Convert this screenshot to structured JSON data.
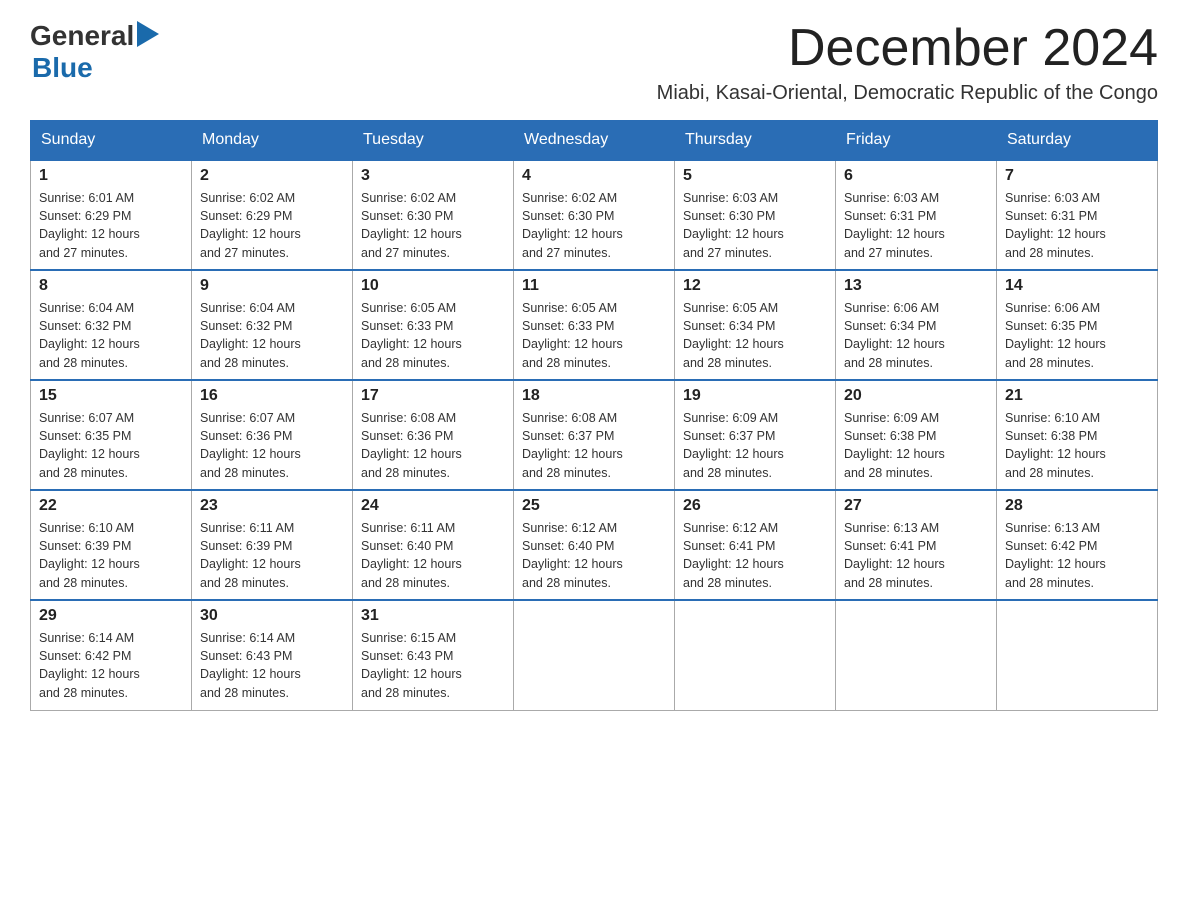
{
  "logo": {
    "general": "General",
    "blue": "Blue"
  },
  "header": {
    "month_year": "December 2024",
    "location": "Miabi, Kasai-Oriental, Democratic Republic of the Congo"
  },
  "weekdays": [
    "Sunday",
    "Monday",
    "Tuesday",
    "Wednesday",
    "Thursday",
    "Friday",
    "Saturday"
  ],
  "weeks": [
    [
      {
        "day": "1",
        "sunrise": "6:01 AM",
        "sunset": "6:29 PM",
        "daylight": "12 hours and 27 minutes."
      },
      {
        "day": "2",
        "sunrise": "6:02 AM",
        "sunset": "6:29 PM",
        "daylight": "12 hours and 27 minutes."
      },
      {
        "day": "3",
        "sunrise": "6:02 AM",
        "sunset": "6:30 PM",
        "daylight": "12 hours and 27 minutes."
      },
      {
        "day": "4",
        "sunrise": "6:02 AM",
        "sunset": "6:30 PM",
        "daylight": "12 hours and 27 minutes."
      },
      {
        "day": "5",
        "sunrise": "6:03 AM",
        "sunset": "6:30 PM",
        "daylight": "12 hours and 27 minutes."
      },
      {
        "day": "6",
        "sunrise": "6:03 AM",
        "sunset": "6:31 PM",
        "daylight": "12 hours and 27 minutes."
      },
      {
        "day": "7",
        "sunrise": "6:03 AM",
        "sunset": "6:31 PM",
        "daylight": "12 hours and 28 minutes."
      }
    ],
    [
      {
        "day": "8",
        "sunrise": "6:04 AM",
        "sunset": "6:32 PM",
        "daylight": "12 hours and 28 minutes."
      },
      {
        "day": "9",
        "sunrise": "6:04 AM",
        "sunset": "6:32 PM",
        "daylight": "12 hours and 28 minutes."
      },
      {
        "day": "10",
        "sunrise": "6:05 AM",
        "sunset": "6:33 PM",
        "daylight": "12 hours and 28 minutes."
      },
      {
        "day": "11",
        "sunrise": "6:05 AM",
        "sunset": "6:33 PM",
        "daylight": "12 hours and 28 minutes."
      },
      {
        "day": "12",
        "sunrise": "6:05 AM",
        "sunset": "6:34 PM",
        "daylight": "12 hours and 28 minutes."
      },
      {
        "day": "13",
        "sunrise": "6:06 AM",
        "sunset": "6:34 PM",
        "daylight": "12 hours and 28 minutes."
      },
      {
        "day": "14",
        "sunrise": "6:06 AM",
        "sunset": "6:35 PM",
        "daylight": "12 hours and 28 minutes."
      }
    ],
    [
      {
        "day": "15",
        "sunrise": "6:07 AM",
        "sunset": "6:35 PM",
        "daylight": "12 hours and 28 minutes."
      },
      {
        "day": "16",
        "sunrise": "6:07 AM",
        "sunset": "6:36 PM",
        "daylight": "12 hours and 28 minutes."
      },
      {
        "day": "17",
        "sunrise": "6:08 AM",
        "sunset": "6:36 PM",
        "daylight": "12 hours and 28 minutes."
      },
      {
        "day": "18",
        "sunrise": "6:08 AM",
        "sunset": "6:37 PM",
        "daylight": "12 hours and 28 minutes."
      },
      {
        "day": "19",
        "sunrise": "6:09 AM",
        "sunset": "6:37 PM",
        "daylight": "12 hours and 28 minutes."
      },
      {
        "day": "20",
        "sunrise": "6:09 AM",
        "sunset": "6:38 PM",
        "daylight": "12 hours and 28 minutes."
      },
      {
        "day": "21",
        "sunrise": "6:10 AM",
        "sunset": "6:38 PM",
        "daylight": "12 hours and 28 minutes."
      }
    ],
    [
      {
        "day": "22",
        "sunrise": "6:10 AM",
        "sunset": "6:39 PM",
        "daylight": "12 hours and 28 minutes."
      },
      {
        "day": "23",
        "sunrise": "6:11 AM",
        "sunset": "6:39 PM",
        "daylight": "12 hours and 28 minutes."
      },
      {
        "day": "24",
        "sunrise": "6:11 AM",
        "sunset": "6:40 PM",
        "daylight": "12 hours and 28 minutes."
      },
      {
        "day": "25",
        "sunrise": "6:12 AM",
        "sunset": "6:40 PM",
        "daylight": "12 hours and 28 minutes."
      },
      {
        "day": "26",
        "sunrise": "6:12 AM",
        "sunset": "6:41 PM",
        "daylight": "12 hours and 28 minutes."
      },
      {
        "day": "27",
        "sunrise": "6:13 AM",
        "sunset": "6:41 PM",
        "daylight": "12 hours and 28 minutes."
      },
      {
        "day": "28",
        "sunrise": "6:13 AM",
        "sunset": "6:42 PM",
        "daylight": "12 hours and 28 minutes."
      }
    ],
    [
      {
        "day": "29",
        "sunrise": "6:14 AM",
        "sunset": "6:42 PM",
        "daylight": "12 hours and 28 minutes."
      },
      {
        "day": "30",
        "sunrise": "6:14 AM",
        "sunset": "6:43 PM",
        "daylight": "12 hours and 28 minutes."
      },
      {
        "day": "31",
        "sunrise": "6:15 AM",
        "sunset": "6:43 PM",
        "daylight": "12 hours and 28 minutes."
      },
      null,
      null,
      null,
      null
    ]
  ],
  "labels": {
    "sunrise": "Sunrise:",
    "sunset": "Sunset:",
    "daylight": "Daylight:"
  }
}
